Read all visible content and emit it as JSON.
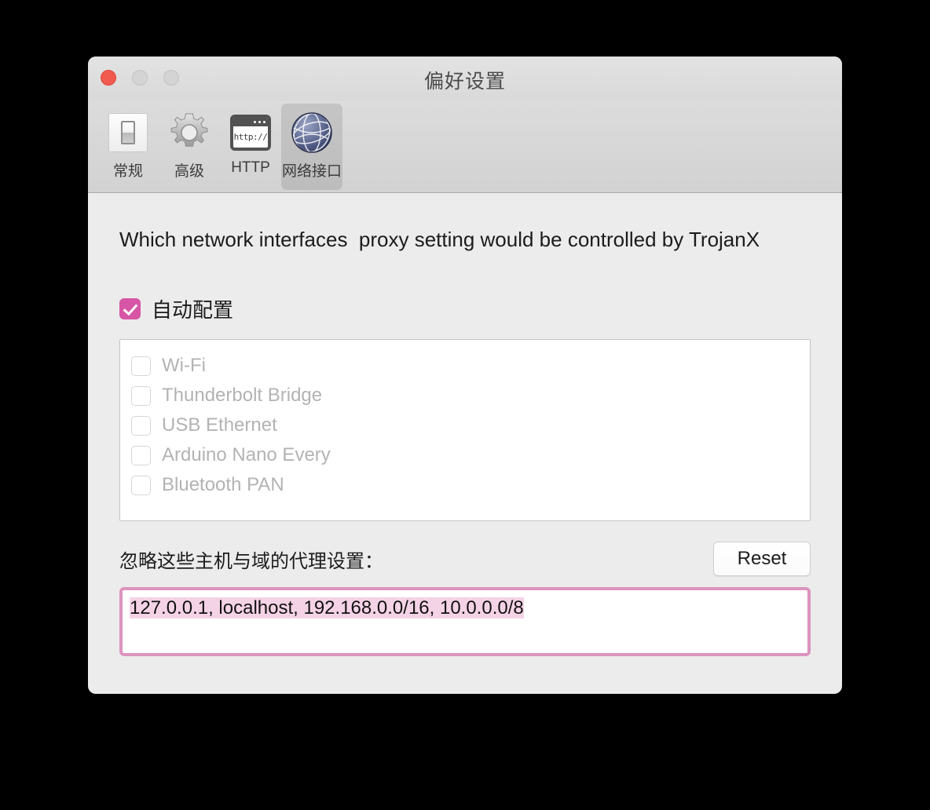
{
  "window": {
    "title": "偏好设置",
    "traffic_lights": [
      {
        "name": "close",
        "color": "#f05a4f"
      },
      {
        "name": "minimize",
        "color": "#d4d4d4"
      },
      {
        "name": "zoom",
        "color": "#d4d4d4"
      }
    ]
  },
  "toolbar": {
    "items": [
      {
        "label": "常规",
        "icon": "switch-icon",
        "selected": false
      },
      {
        "label": "高级",
        "icon": "gear-icon",
        "selected": false
      },
      {
        "label": "HTTP",
        "icon": "http-icon",
        "selected": false
      },
      {
        "label": "网络接口",
        "icon": "globe-icon",
        "selected": true
      }
    ]
  },
  "main": {
    "description": "Which network interfaces  proxy setting would be controlled by TrojanX",
    "auto_config": {
      "label": "自动配置",
      "checked": true,
      "accent_color": "#d655a5"
    },
    "interfaces": {
      "enabled": false,
      "items": [
        {
          "label": "Wi-Fi",
          "checked": false
        },
        {
          "label": "Thunderbolt Bridge",
          "checked": false
        },
        {
          "label": "USB Ethernet",
          "checked": false
        },
        {
          "label": "Arduino Nano Every",
          "checked": false
        },
        {
          "label": "Bluetooth PAN",
          "checked": false
        }
      ]
    },
    "bypass": {
      "label": "忽略这些主机与域的代理设置：",
      "reset_label": "Reset",
      "value": "127.0.0.1, localhost, 192.168.0.0/16, 10.0.0.0/8",
      "selected": true,
      "focus_ring_color": "#dc94bd",
      "selection_color": "#f5d3e6"
    }
  },
  "icons": {
    "http_text": "http://"
  }
}
